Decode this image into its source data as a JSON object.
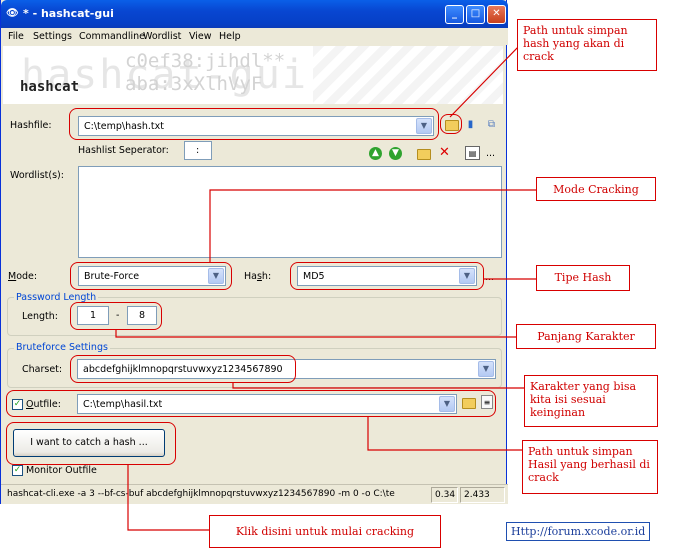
{
  "window": {
    "title": "* - hashcat-gui",
    "app_icon": "eye-icon",
    "controls": [
      "_",
      "□",
      "✕"
    ]
  },
  "menu": [
    "File",
    "Settings",
    "Commandline",
    "Wordlist",
    "View",
    "Help"
  ],
  "banner": {
    "logo": "hashcat",
    "bg_text": "hashcat-gui",
    "bg_code_1": "c0ef38:jihdl**",
    "bg_code_2": "aba:3xXlhVyF"
  },
  "hashfile": {
    "label": "Hashfile:",
    "value": "C:\\temp\\hash.txt"
  },
  "separator": {
    "label": "Hashlist Seperator:",
    "value": ":"
  },
  "wordlist": {
    "label": "Wordlist(s):"
  },
  "mode": {
    "label": "Mode:",
    "value": "Brute-Force"
  },
  "hash": {
    "label": "Hash:",
    "value": "MD5",
    "more": "..."
  },
  "password_length": {
    "title": "Password Length",
    "label": "Length:",
    "min": "1",
    "dash": "-",
    "max": "8"
  },
  "bruteforce": {
    "title": "Bruteforce Settings",
    "label": "Charset:",
    "value": "abcdefghijklmnopqrstuvwxyz1234567890"
  },
  "outfile": {
    "label": "Outfile:",
    "value": "C:\\temp\\hasil.txt",
    "checked": true
  },
  "start_button": "I want to catch a hash ...",
  "monitor_outfile": {
    "label": "Monitor Outfile",
    "checked": true
  },
  "statusbar": {
    "command": "hashcat-cli.exe -a 3 --bf-cs-buf abcdefghijklmnopqrstuvwxyz1234567890 -m 0 -o C:\\te",
    "v1": "0.34",
    "v2": "2.433"
  },
  "toolbar_more": "...",
  "callouts": {
    "hashfile": "Path untuk simpan hash yang akan di crack",
    "mode": "Mode Cracking",
    "hash_type": "Tipe Hash",
    "length": "Panjang Karakter",
    "charset": "Karakter yang bisa kita isi sesuai keinginan",
    "outfile": "Path untuk simpan Hasil yang berhasil di crack",
    "start": "Klik disini untuk mulai cracking"
  },
  "footer_link": "Http://forum.xcode.or.id",
  "colors": {
    "annotation": "#d80000",
    "titlebar": "#0846d1",
    "group_title": "#0046d5"
  }
}
